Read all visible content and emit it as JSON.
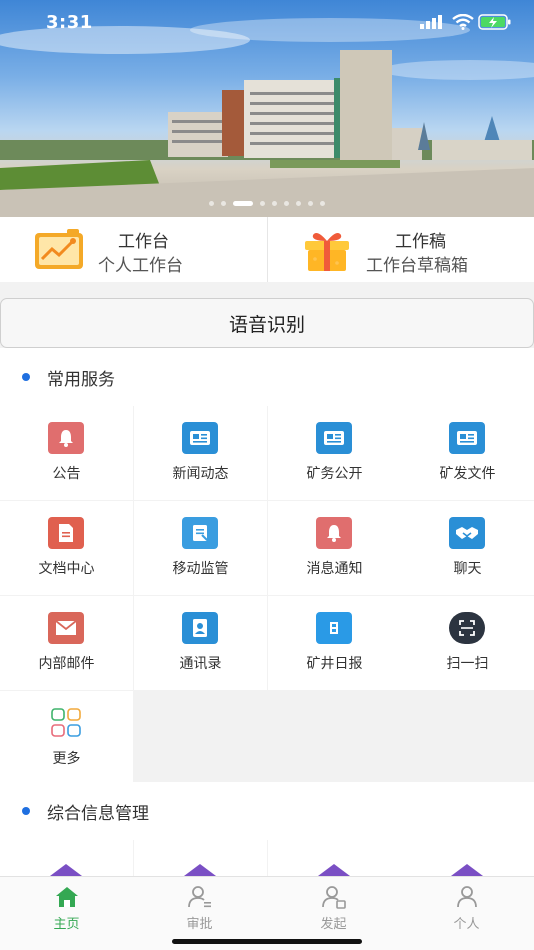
{
  "status_bar": {
    "time": "3:31"
  },
  "quick_cards": [
    {
      "title": "工作台",
      "subtitle": "个人工作台",
      "icon": "chart-board-icon"
    },
    {
      "title": "工作稿",
      "subtitle": "工作台草稿箱",
      "icon": "gift-box-icon"
    }
  ],
  "voice_button": {
    "label": "语音识别"
  },
  "sections": {
    "common_services": {
      "title": "常用服务",
      "items": [
        {
          "label": "公告",
          "icon": "bell-icon",
          "color": "#e06e6e"
        },
        {
          "label": "新闻动态",
          "icon": "newspaper-icon",
          "color": "#2a8fd6"
        },
        {
          "label": "矿务公开",
          "icon": "newspaper-icon",
          "color": "#2a8fd6"
        },
        {
          "label": "矿发文件",
          "icon": "newspaper-icon",
          "color": "#2a8fd6"
        },
        {
          "label": "文档中心",
          "icon": "document-icon",
          "color": "#e0604f"
        },
        {
          "label": "移动监管",
          "icon": "notebook-icon",
          "color": "#3a9de0"
        },
        {
          "label": "消息通知",
          "icon": "bell-icon",
          "color": "#e06e6e"
        },
        {
          "label": "聊天",
          "icon": "handshake-icon",
          "color": "#2a8fd6"
        },
        {
          "label": "内部邮件",
          "icon": "mail-icon",
          "color": "#d9675a"
        },
        {
          "label": "通讯录",
          "icon": "contacts-icon",
          "color": "#2a8fd6"
        },
        {
          "label": "矿井日报",
          "icon": "daily-report-icon",
          "color": "#2a9ae6"
        },
        {
          "label": "扫一扫",
          "icon": "scan-icon",
          "color": "#2c3440"
        },
        {
          "label": "更多",
          "icon": "more-grid-icon",
          "color": "#ffffff"
        }
      ]
    },
    "info_management": {
      "title": "综合信息管理"
    }
  },
  "tabbar": [
    {
      "label": "主页",
      "icon": "home-icon",
      "active": true
    },
    {
      "label": "审批",
      "icon": "approve-icon",
      "active": false
    },
    {
      "label": "发起",
      "icon": "initiate-icon",
      "active": false
    },
    {
      "label": "个人",
      "icon": "person-icon",
      "active": false
    }
  ],
  "colors": {
    "accent_blue": "#1f6fe0",
    "tab_active": "#34a853",
    "tab_inactive": "#999999"
  }
}
